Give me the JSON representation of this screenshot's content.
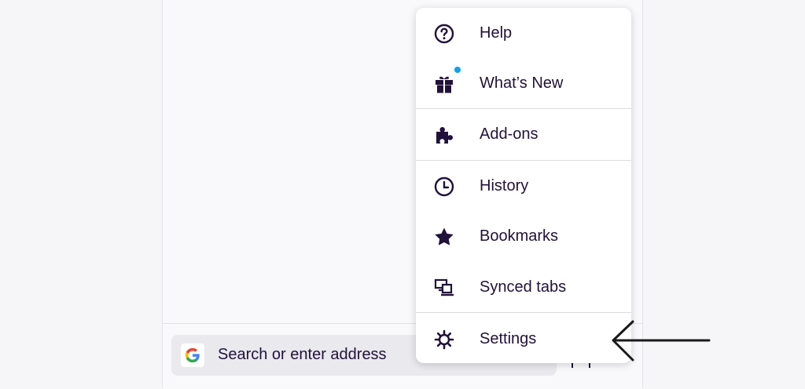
{
  "url_bar": {
    "placeholder": "Search or enter address",
    "engine_icon": "google-g-icon"
  },
  "menu": {
    "items": [
      {
        "label": "Help",
        "icon": "help-circle-icon"
      },
      {
        "label": "What’s New",
        "icon": "gift-icon",
        "badge": "notification-dot"
      },
      {
        "label": "Add-ons",
        "icon": "puzzle-piece-icon"
      },
      {
        "label": "History",
        "icon": "clock-icon"
      },
      {
        "label": "Bookmarks",
        "icon": "star-icon"
      },
      {
        "label": "Synced tabs",
        "icon": "synced-devices-icon"
      },
      {
        "label": "Settings",
        "icon": "gear-icon"
      }
    ]
  },
  "annotation": {
    "icon": "arrow-left-icon",
    "points_to": "Settings"
  },
  "colors": {
    "text": "#20123a",
    "notification_dot": "#0fa0e8",
    "menu_bg": "#ffffff",
    "page_bg": "#f9f9fb",
    "url_bar_bg": "#e9e9ee"
  }
}
